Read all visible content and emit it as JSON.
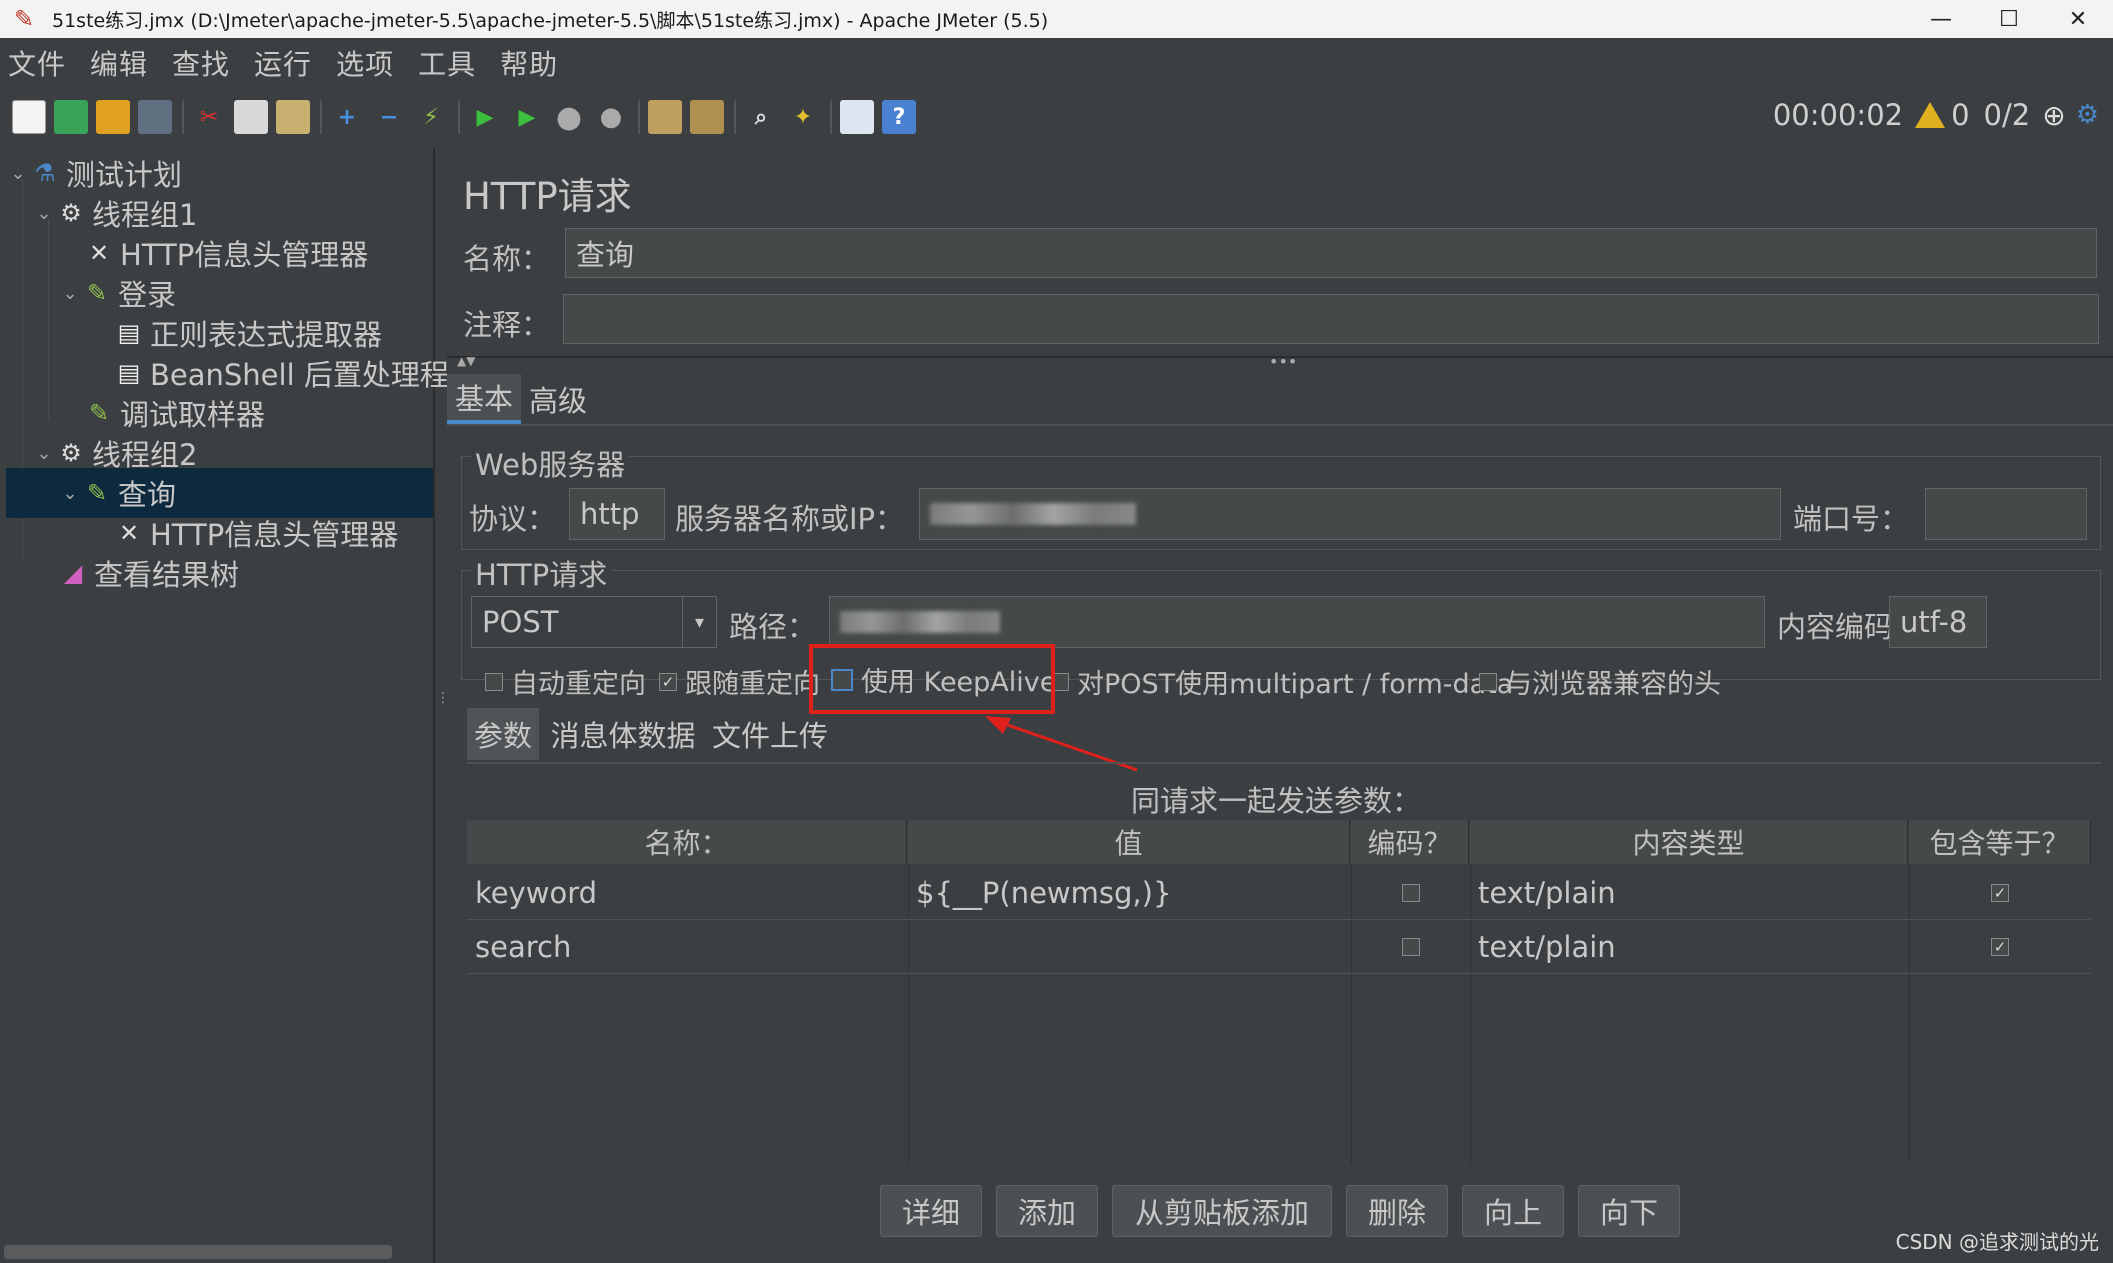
{
  "window": {
    "title": "51ste练习.jmx (D:\\Jmeter\\apache-jmeter-5.5\\apache-jmeter-5.5\\脚本\\51ste练习.jmx) - Apache JMeter (5.5)",
    "minimize": "—",
    "maximize": "☐",
    "close": "✕"
  },
  "menu": [
    "文件",
    "编辑",
    "查找",
    "运行",
    "选项",
    "工具",
    "帮助"
  ],
  "toolbar": {
    "timer": "00:00:02",
    "warnings": "0",
    "threads": "0/2"
  },
  "tree": {
    "items": [
      {
        "label": "测试计划"
      },
      {
        "label": "线程组1"
      },
      {
        "label": "HTTP信息头管理器"
      },
      {
        "label": "登录"
      },
      {
        "label": "正则表达式提取器"
      },
      {
        "label": "BeanShell 后置处理程"
      },
      {
        "label": "调试取样器"
      },
      {
        "label": "线程组2"
      },
      {
        "label": "查询"
      },
      {
        "label": "HTTP信息头管理器"
      },
      {
        "label": "查看结果树"
      }
    ]
  },
  "panel": {
    "title": "HTTP请求",
    "name_label": "名称：",
    "name_value": "查询",
    "comment_label": "注释：",
    "comment_value": "",
    "tabs": [
      "基本",
      "高级"
    ],
    "web_server": {
      "section": "Web服务器",
      "protocol_label": "协议：",
      "protocol_value": "http",
      "server_label": "服务器名称或IP：",
      "port_label": "端口号："
    },
    "http_request": {
      "section": "HTTP请求",
      "method": "POST",
      "path_label": "路径：",
      "encoding_label": "内容编码：",
      "encoding_value": "utf-8"
    },
    "options": [
      {
        "label": "自动重定向",
        "checked": false
      },
      {
        "label": "跟随重定向",
        "checked": true
      },
      {
        "label": "使用 KeepAlive",
        "checked": false
      },
      {
        "label": "对POST使用multipart / form-data",
        "checked": false
      },
      {
        "label": "与浏览器兼容的头",
        "checked": false
      }
    ],
    "sub_tabs": [
      "参数",
      "消息体数据",
      "文件上传"
    ],
    "params_caption": "同请求一起发送参数：",
    "table": {
      "headers": [
        "名称：",
        "值",
        "编码？",
        "内容类型",
        "包含等于？"
      ],
      "rows": [
        {
          "name": "keyword",
          "value": "${__P(newmsg,)}",
          "encode": false,
          "content_type": "text/plain",
          "include_equals": true
        },
        {
          "name": "search",
          "value": "",
          "encode": false,
          "content_type": "text/plain",
          "include_equals": true
        }
      ]
    },
    "buttons": [
      "详细",
      "添加",
      "从剪贴板添加",
      "删除",
      "向上",
      "向下"
    ]
  },
  "watermark": "CSDN @追求测试的光"
}
